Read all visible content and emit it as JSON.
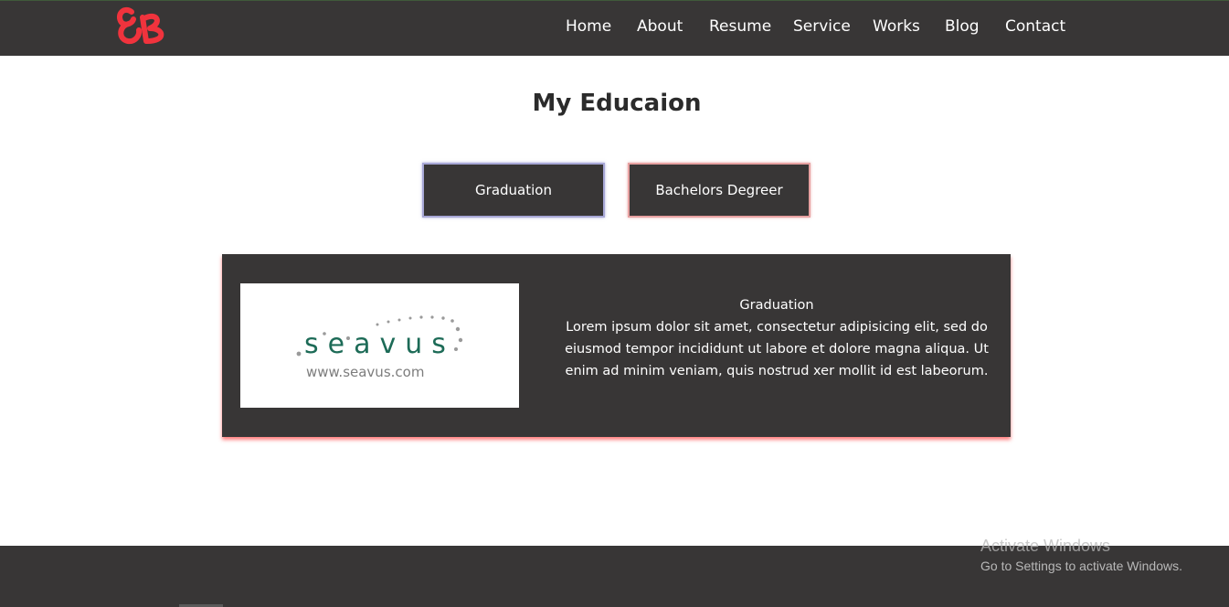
{
  "header": {
    "logo": "logo-icon",
    "nav": [
      "Home",
      "About",
      "Resume",
      "Service",
      "Works",
      "Blog",
      "Contact"
    ]
  },
  "main": {
    "title": "My Educaion",
    "tabs": [
      "Graduation",
      "Bachelors Degreer"
    ],
    "card": {
      "logo_brand": "seavus",
      "logo_url": "www.seavus.com",
      "heading": "Graduation",
      "text": "Lorem ipsum dolor sit amet, consectetur adipisicing elit, sed do eiusmod tempor incididunt ut labore et dolore magna aliqua. Ut enim ad minim veniam, quis nostrud xer mollit id est labeorum."
    }
  },
  "watermark": {
    "title": "Activate Windows",
    "subtitle": "Go to Settings to activate Windows."
  },
  "colors": {
    "bar": "#383636",
    "accent": "#f0333d",
    "brand_green": "#1d6b57"
  }
}
